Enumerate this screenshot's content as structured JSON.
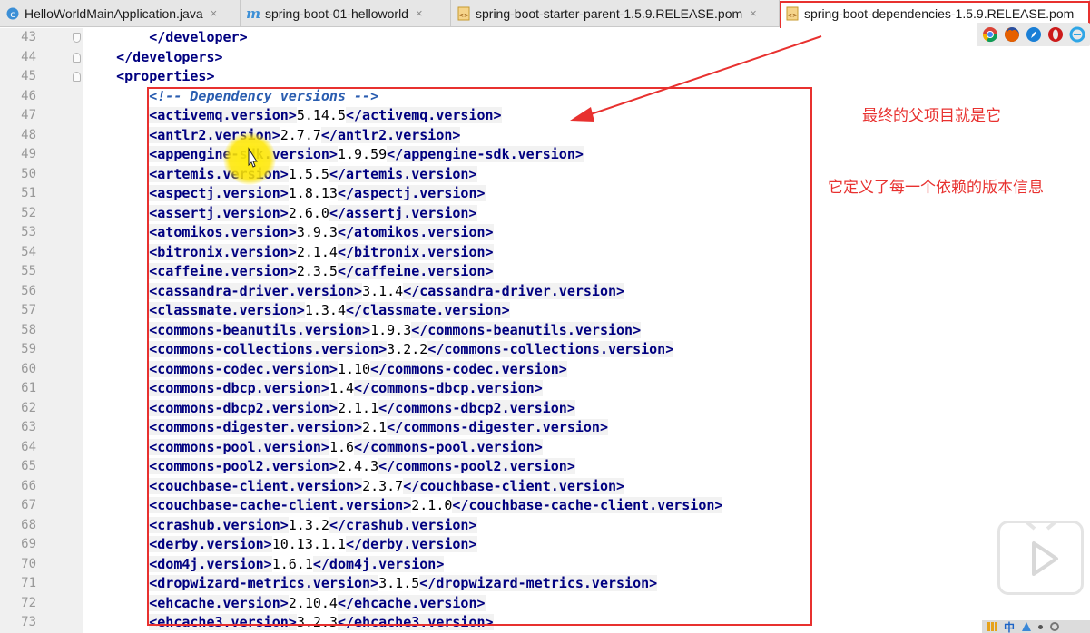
{
  "tabs": [
    {
      "label": "HelloWorldMainApplication.java",
      "icon": "java-class-icon",
      "active": false
    },
    {
      "label": "spring-boot-01-helloworld",
      "icon": "maven-module-icon",
      "active": false
    },
    {
      "label": "spring-boot-starter-parent-1.5.9.RELEASE.pom",
      "icon": "xml-file-icon",
      "active": false
    },
    {
      "label": "spring-boot-dependencies-1.5.9.RELEASE.pom",
      "icon": "xml-file-icon",
      "active": true
    }
  ],
  "close_glyph": "×",
  "lines": [
    {
      "no": "43",
      "indent": "        ",
      "parts": [
        [
          "tg",
          "</developer>"
        ]
      ]
    },
    {
      "no": "44",
      "indent": "    ",
      "parts": [
        [
          "tg",
          "</developers>"
        ]
      ]
    },
    {
      "no": "45",
      "indent": "    ",
      "parts": [
        [
          "tg",
          "<properties>"
        ]
      ]
    },
    {
      "no": "46",
      "indent": "        ",
      "parts": [
        [
          "cm",
          "<!-- Dependency versions -->"
        ]
      ]
    },
    {
      "no": "47",
      "indent": "        ",
      "parts": [
        [
          "tg",
          "<activemq.version>"
        ],
        [
          "vl",
          "5.14.5"
        ],
        [
          "tg",
          "</activemq.version>"
        ]
      ]
    },
    {
      "no": "48",
      "indent": "        ",
      "parts": [
        [
          "tg",
          "<antlr2.version>"
        ],
        [
          "vl",
          "2.7.7"
        ],
        [
          "tg",
          "</antlr2.version>"
        ]
      ]
    },
    {
      "no": "49",
      "indent": "        ",
      "parts": [
        [
          "tg",
          "<appengine-sdk.version>"
        ],
        [
          "vl",
          "1.9.59"
        ],
        [
          "tg",
          "</appengine-sdk.version>"
        ]
      ]
    },
    {
      "no": "50",
      "indent": "        ",
      "parts": [
        [
          "tg",
          "<artemis.version>"
        ],
        [
          "vl",
          "1.5.5"
        ],
        [
          "tg",
          "</artemis.version>"
        ]
      ]
    },
    {
      "no": "51",
      "indent": "        ",
      "parts": [
        [
          "tg",
          "<aspectj.version>"
        ],
        [
          "vl",
          "1.8.13"
        ],
        [
          "tg",
          "</aspectj.version>"
        ]
      ]
    },
    {
      "no": "52",
      "indent": "        ",
      "parts": [
        [
          "tg",
          "<assertj.version>"
        ],
        [
          "vl",
          "2.6.0"
        ],
        [
          "tg",
          "</assertj.version>"
        ]
      ]
    },
    {
      "no": "53",
      "indent": "        ",
      "parts": [
        [
          "tg",
          "<atomikos.version>"
        ],
        [
          "vl",
          "3.9.3"
        ],
        [
          "tg",
          "</atomikos.version>"
        ]
      ]
    },
    {
      "no": "54",
      "indent": "        ",
      "parts": [
        [
          "tg",
          "<bitronix.version>"
        ],
        [
          "vl",
          "2.1.4"
        ],
        [
          "tg",
          "</bitronix.version>"
        ]
      ]
    },
    {
      "no": "55",
      "indent": "        ",
      "parts": [
        [
          "tg",
          "<caffeine.version>"
        ],
        [
          "vl",
          "2.3.5"
        ],
        [
          "tg",
          "</caffeine.version>"
        ]
      ]
    },
    {
      "no": "56",
      "indent": "        ",
      "parts": [
        [
          "tg",
          "<cassandra-driver.version>"
        ],
        [
          "vl",
          "3.1.4"
        ],
        [
          "tg",
          "</cassandra-driver.version>"
        ]
      ]
    },
    {
      "no": "57",
      "indent": "        ",
      "parts": [
        [
          "tg",
          "<classmate.version>"
        ],
        [
          "vl",
          "1.3.4"
        ],
        [
          "tg",
          "</classmate.version>"
        ]
      ]
    },
    {
      "no": "58",
      "indent": "        ",
      "parts": [
        [
          "tg",
          "<commons-beanutils.version>"
        ],
        [
          "vl",
          "1.9.3"
        ],
        [
          "tg",
          "</commons-beanutils.version>"
        ]
      ]
    },
    {
      "no": "59",
      "indent": "        ",
      "parts": [
        [
          "tg",
          "<commons-collections.version>"
        ],
        [
          "vl",
          "3.2.2"
        ],
        [
          "tg",
          "</commons-collections.version>"
        ]
      ]
    },
    {
      "no": "60",
      "indent": "        ",
      "parts": [
        [
          "tg",
          "<commons-codec.version>"
        ],
        [
          "vl",
          "1.10"
        ],
        [
          "tg",
          "</commons-codec.version>"
        ]
      ]
    },
    {
      "no": "61",
      "indent": "        ",
      "parts": [
        [
          "tg",
          "<commons-dbcp.version>"
        ],
        [
          "vl",
          "1.4"
        ],
        [
          "tg",
          "</commons-dbcp.version>"
        ]
      ]
    },
    {
      "no": "62",
      "indent": "        ",
      "parts": [
        [
          "tg",
          "<commons-dbcp2.version>"
        ],
        [
          "vl",
          "2.1.1"
        ],
        [
          "tg",
          "</commons-dbcp2.version>"
        ]
      ]
    },
    {
      "no": "63",
      "indent": "        ",
      "parts": [
        [
          "tg",
          "<commons-digester.version>"
        ],
        [
          "vl",
          "2.1"
        ],
        [
          "tg",
          "</commons-digester.version>"
        ]
      ]
    },
    {
      "no": "64",
      "indent": "        ",
      "parts": [
        [
          "tg",
          "<commons-pool.version>"
        ],
        [
          "vl",
          "1.6"
        ],
        [
          "tg",
          "</commons-pool.version>"
        ]
      ]
    },
    {
      "no": "65",
      "indent": "        ",
      "parts": [
        [
          "tg",
          "<commons-pool2.version>"
        ],
        [
          "vl",
          "2.4.3"
        ],
        [
          "tg",
          "</commons-pool2.version>"
        ]
      ]
    },
    {
      "no": "66",
      "indent": "        ",
      "parts": [
        [
          "tg",
          "<couchbase-client.version>"
        ],
        [
          "vl",
          "2.3.7"
        ],
        [
          "tg",
          "</couchbase-client.version>"
        ]
      ]
    },
    {
      "no": "67",
      "indent": "        ",
      "parts": [
        [
          "tg",
          "<couchbase-cache-client.version>"
        ],
        [
          "vl",
          "2.1.0"
        ],
        [
          "tg",
          "</couchbase-cache-client.version>"
        ]
      ]
    },
    {
      "no": "68",
      "indent": "        ",
      "parts": [
        [
          "tg",
          "<crashub.version>"
        ],
        [
          "vl",
          "1.3.2"
        ],
        [
          "tg",
          "</crashub.version>"
        ]
      ]
    },
    {
      "no": "69",
      "indent": "        ",
      "parts": [
        [
          "tg",
          "<derby.version>"
        ],
        [
          "vl",
          "10.13.1.1"
        ],
        [
          "tg",
          "</derby.version>"
        ]
      ]
    },
    {
      "no": "70",
      "indent": "        ",
      "parts": [
        [
          "tg",
          "<dom4j.version>"
        ],
        [
          "vl",
          "1.6.1"
        ],
        [
          "tg",
          "</dom4j.version>"
        ]
      ]
    },
    {
      "no": "71",
      "indent": "        ",
      "parts": [
        [
          "tg",
          "<dropwizard-metrics.version>"
        ],
        [
          "vl",
          "3.1.5"
        ],
        [
          "tg",
          "</dropwizard-metrics.version>"
        ]
      ]
    },
    {
      "no": "72",
      "indent": "        ",
      "parts": [
        [
          "tg",
          "<ehcache.version>"
        ],
        [
          "vl",
          "2.10.4"
        ],
        [
          "tg",
          "</ehcache.version>"
        ]
      ]
    },
    {
      "no": "73",
      "indent": "        ",
      "parts": [
        [
          "tg",
          "<ehcache3.version>"
        ],
        [
          "vl",
          "3.2.3"
        ],
        [
          "tg",
          "</ehcache3.version>"
        ]
      ]
    }
  ],
  "annotations": {
    "parent_note": "最终的父项目就是它",
    "versions_note": "它定义了每一个依赖的版本信息"
  },
  "browser_icons": [
    "chrome-icon",
    "firefox-icon",
    "safari-icon",
    "opera-icon",
    "ie-icon"
  ],
  "tray": {
    "ime": "中"
  },
  "colors": {
    "annotation_red": "#e8312f",
    "tag_blue": "#000080",
    "comment": "#2a5db0",
    "gutter": "#f0f0f0",
    "cursor_highlight": "#ffe600"
  }
}
